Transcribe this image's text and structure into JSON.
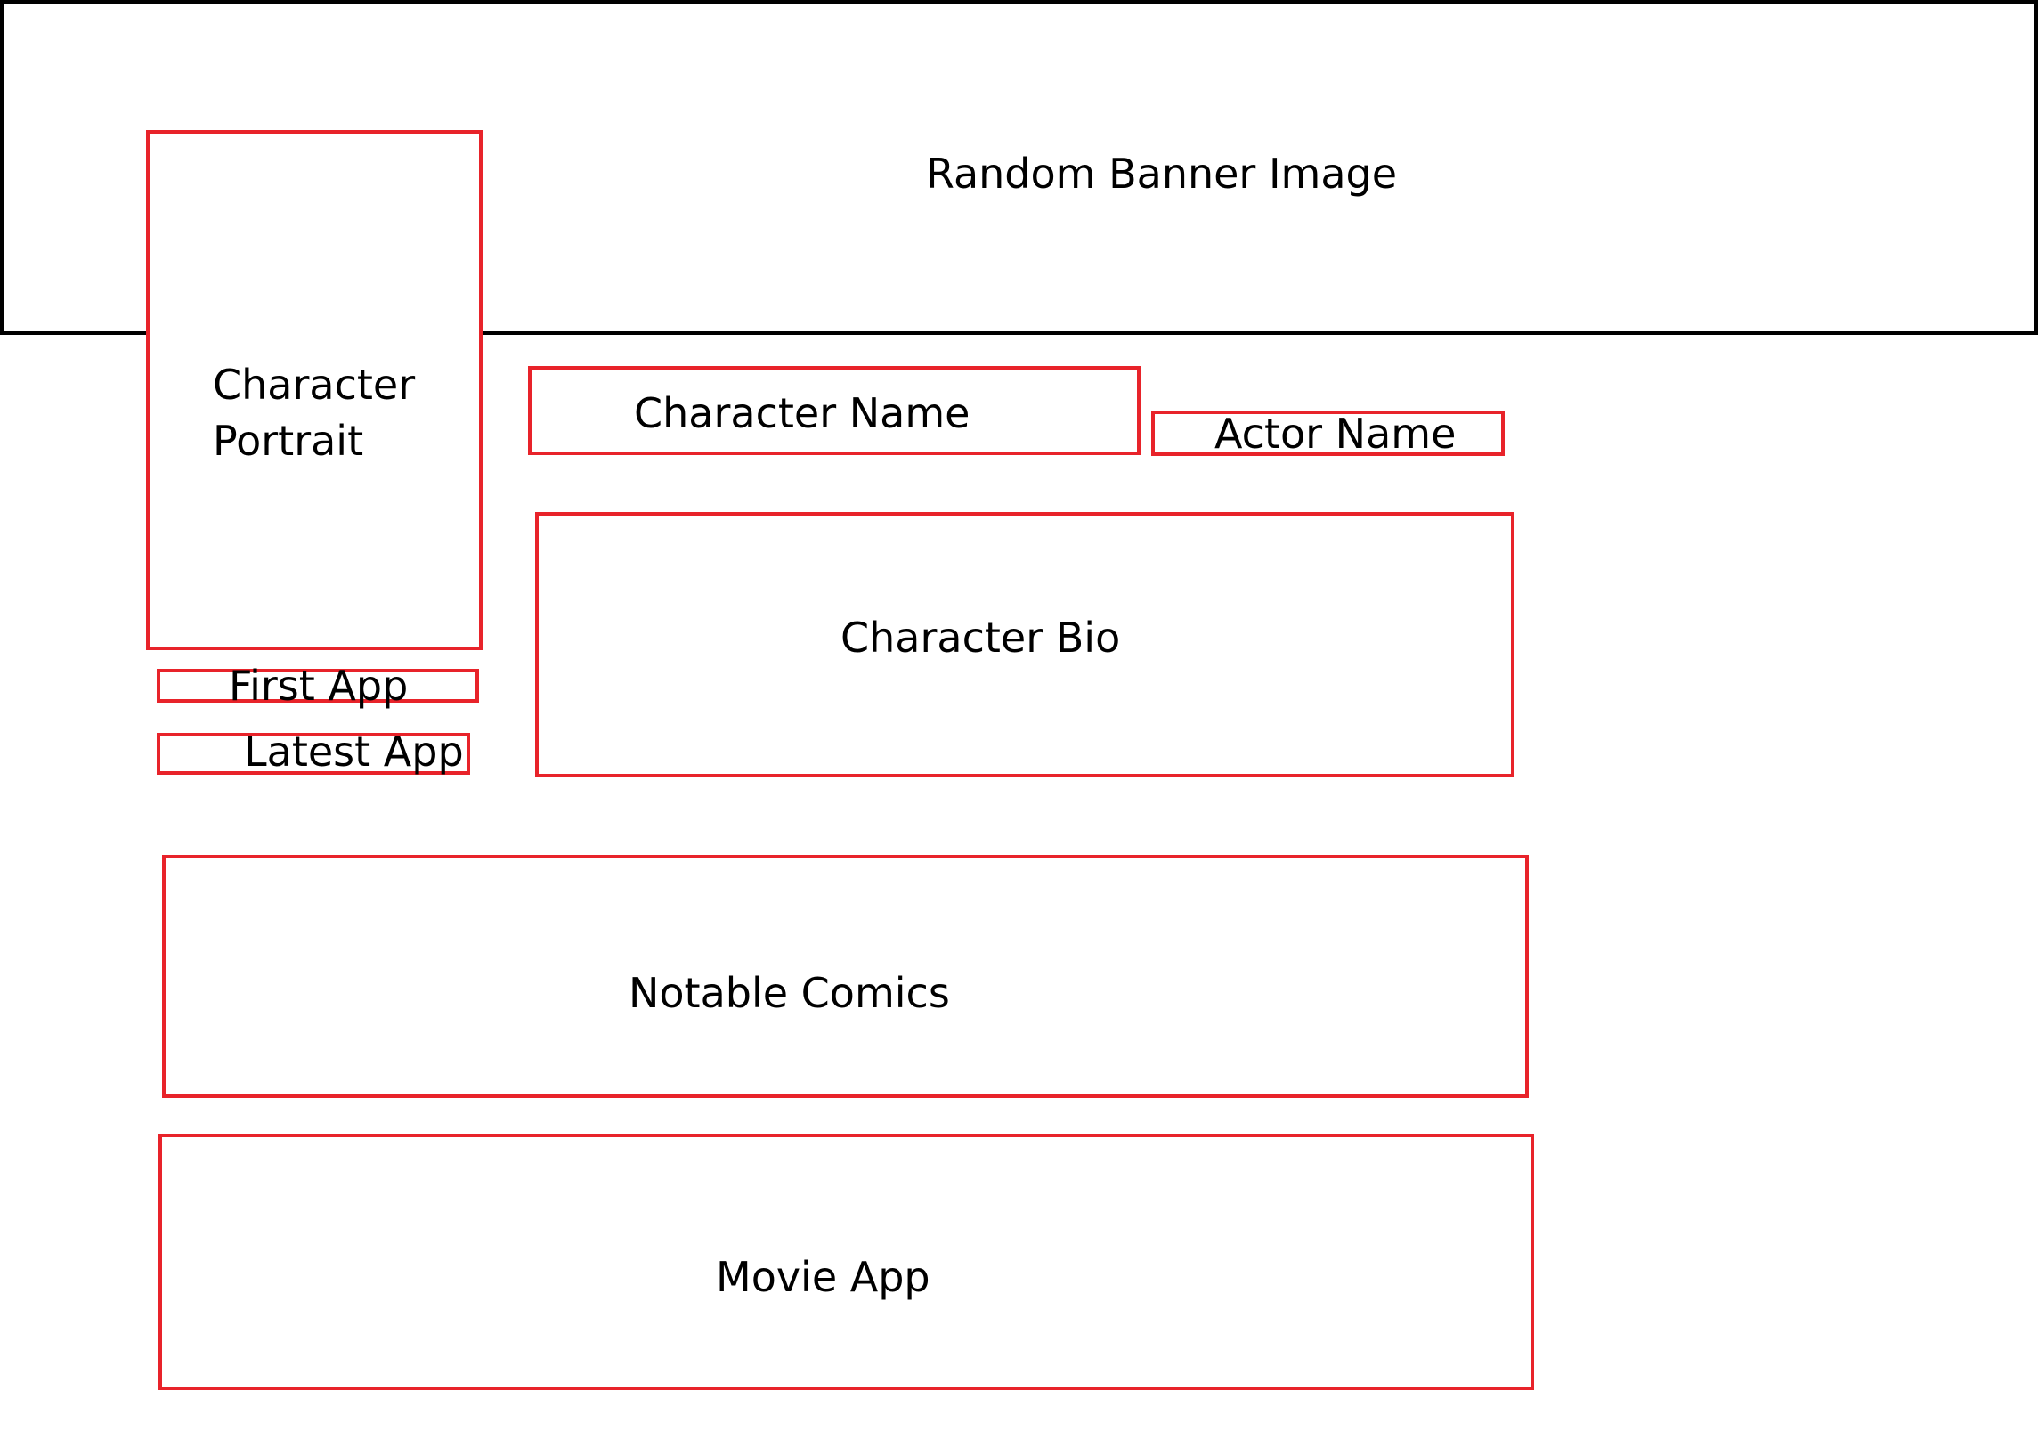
{
  "banner": {
    "label": "Random Banner Image"
  },
  "portrait": {
    "line1": "Character",
    "line2": "Portrait"
  },
  "character_name": {
    "label": "Character Name"
  },
  "actor_name": {
    "label": "Actor Name"
  },
  "bio": {
    "label": "Character Bio"
  },
  "first_app": {
    "label": "First App"
  },
  "latest_app": {
    "label": "Latest App"
  },
  "notable_comics": {
    "label": "Notable Comics"
  },
  "movie_app": {
    "label": "Movie App"
  },
  "colors": {
    "outline": "#000000",
    "wireframe_box": "#e8232a"
  }
}
